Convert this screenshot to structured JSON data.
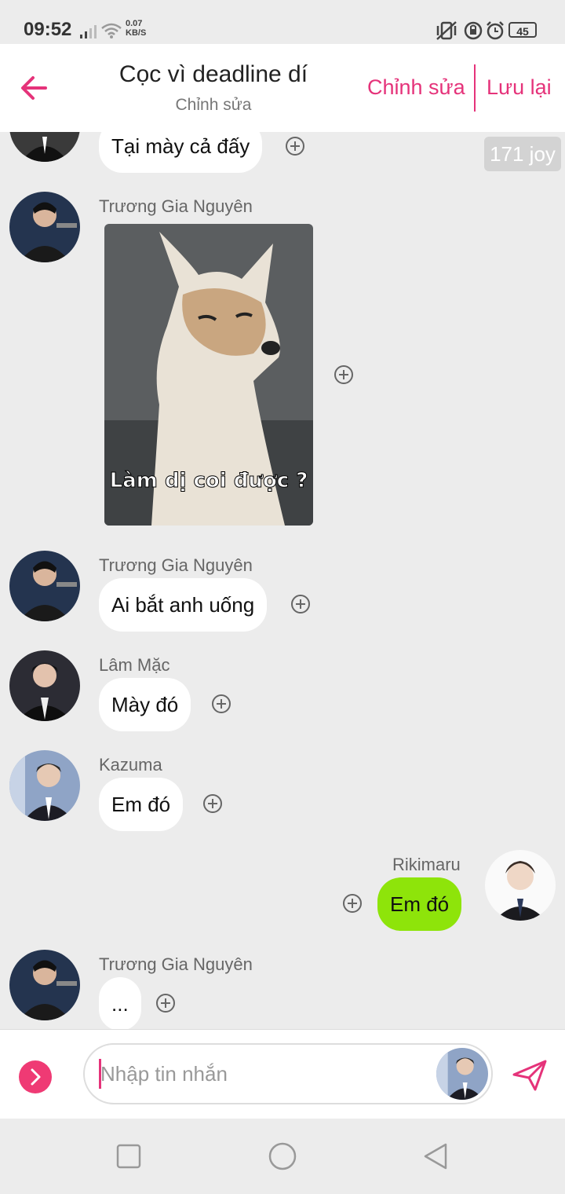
{
  "status": {
    "time": "09:52",
    "net_speed_value": "0.07",
    "net_speed_unit": "KB/S",
    "battery": "45"
  },
  "header": {
    "title": "Cọc vì deadline dí",
    "subtitle": "Chỉnh sửa",
    "edit_label": "Chỉnh sửa",
    "save_label": "Lưu lại"
  },
  "joy_badge": "171 joy",
  "messages": [
    {
      "text": "Tại mày cả đấy"
    },
    {
      "sender": "Trương Gia Nguyên",
      "image_caption": "Làm dị coi được ?"
    },
    {
      "sender": "Trương Gia Nguyên",
      "text": "Ai bắt anh uống"
    },
    {
      "sender": "Lâm Mặc",
      "text": "Mày đó"
    },
    {
      "sender": "Kazuma",
      "text": "Em đó"
    },
    {
      "sender": "Rikimaru",
      "text": "Em đó"
    },
    {
      "sender": "Trương Gia Nguyên",
      "text": "..."
    }
  ],
  "composer": {
    "placeholder": "Nhập tin nhắn"
  },
  "colors": {
    "accent": "#e5337a",
    "own_bubble": "#8ee40a",
    "background": "#ececec"
  },
  "icons": {
    "back": "arrow-left-icon",
    "add_reaction": "plus-circle-icon",
    "send": "send-icon",
    "expand": "chevron-right-icon"
  }
}
